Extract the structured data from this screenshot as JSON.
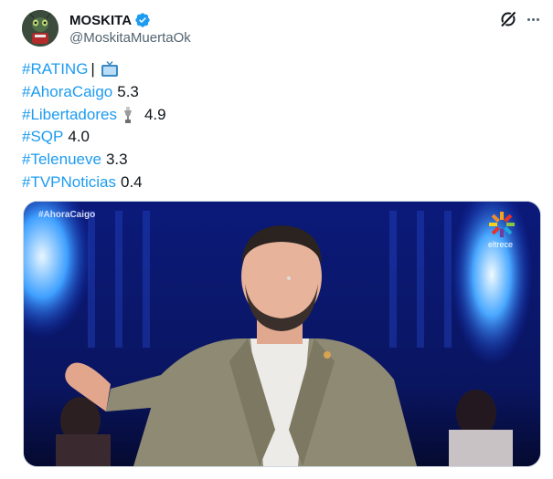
{
  "author": {
    "display_name": "MOSKITA",
    "handle": "@MoskitaMuertaOk",
    "verified": true
  },
  "icons": {
    "avatar": "avatar-image",
    "verified": "verified-badge-icon",
    "grok": "grok-icon",
    "more": "more-options-icon",
    "tv": "television-emoji",
    "trophy": "trophy-emoji"
  },
  "tweet": {
    "lines": [
      {
        "tag": "#RATING",
        "suffix": "|"
      },
      {
        "tag": "#AhoraCaigo",
        "value": "5.3"
      },
      {
        "tag": "#Libertadores",
        "value": "4.9"
      },
      {
        "tag": "#SQP",
        "value": "4.0"
      },
      {
        "tag": "#Telenueve",
        "value": "3.3"
      },
      {
        "tag": "#TVPNoticias",
        "value": "0.4"
      }
    ]
  },
  "media": {
    "overlay_tag": "#AhoraCaigo",
    "channel_logo_text": "eltrece"
  },
  "colors": {
    "link": "#1d9bf0",
    "text": "#0f1419",
    "secondary": "#536471",
    "verified": "#1d9bf0"
  }
}
